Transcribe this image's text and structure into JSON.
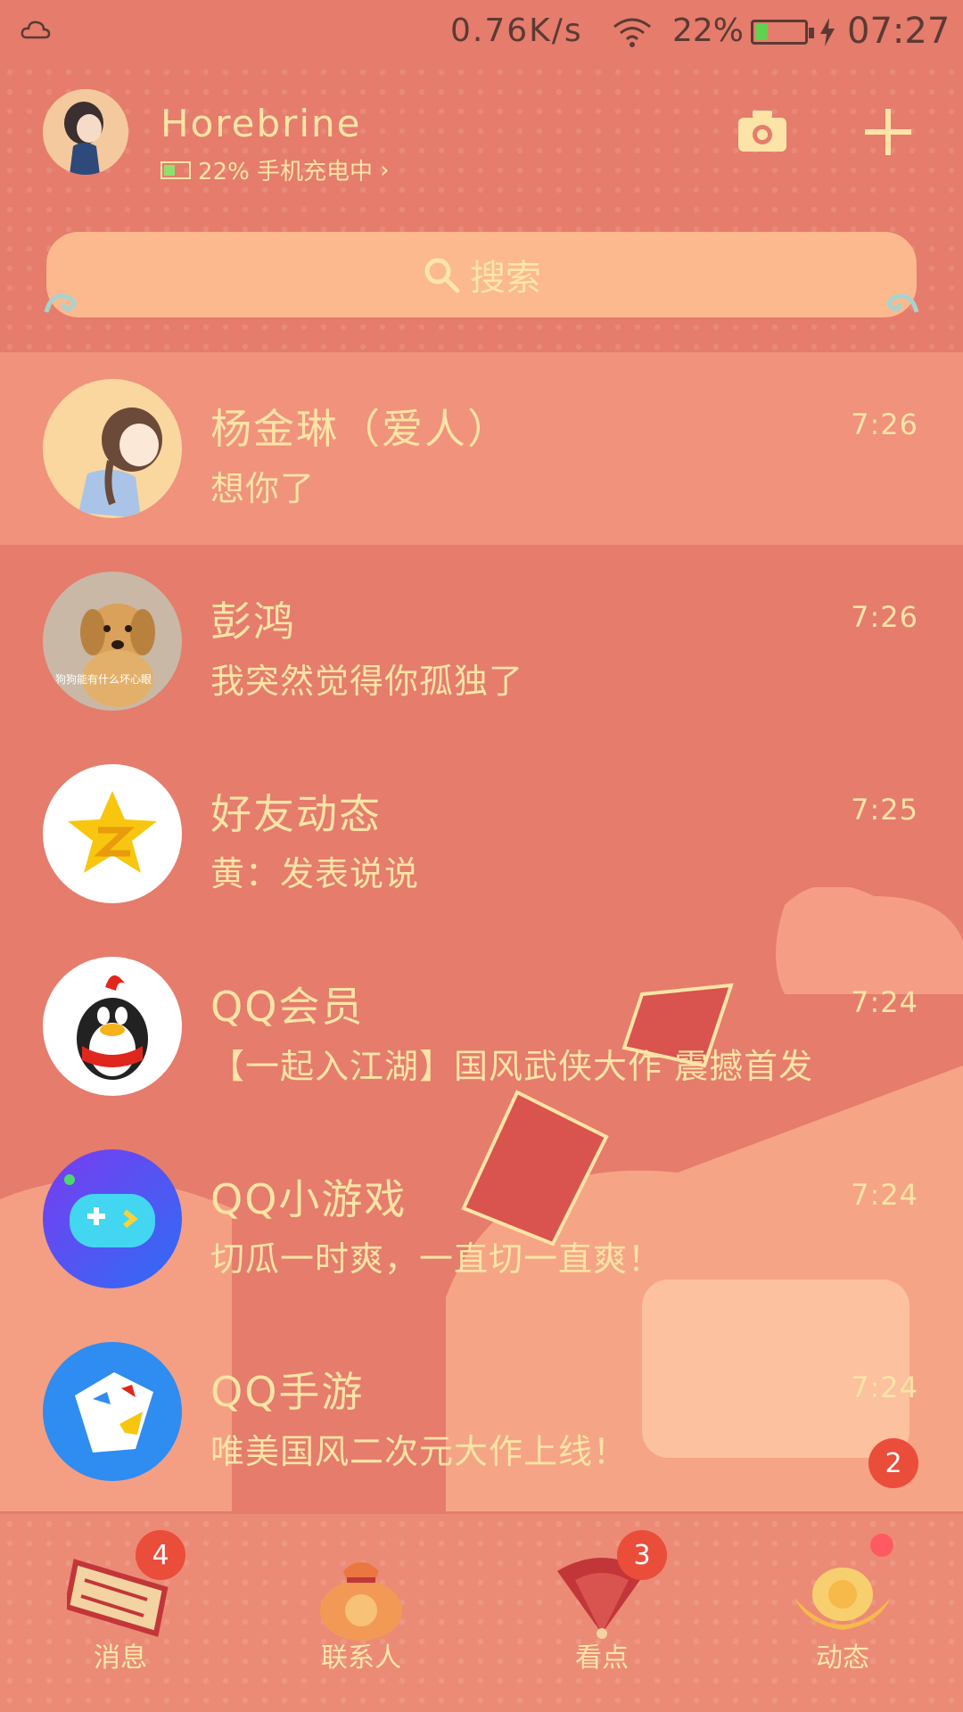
{
  "status_bar": {
    "speed": "0.76K/s",
    "battery_percent": "22%",
    "time": "07:27",
    "icons": [
      "cloud-icon",
      "wifi-icon",
      "battery-icon",
      "charging-bolt-icon"
    ]
  },
  "header": {
    "username": "Horebrine",
    "device_status": "22% 手机充电中",
    "actions": [
      "camera-icon",
      "plus-icon"
    ]
  },
  "search": {
    "label": "搜索"
  },
  "chats": [
    {
      "name": "杨金琳（爱人）",
      "message": "想你了",
      "time": "7:26",
      "pinned": true,
      "unread": null
    },
    {
      "name": "彭鸿",
      "message": "我突然觉得你孤独了",
      "time": "7:26",
      "pinned": false,
      "unread": null,
      "avatar_caption": "狗狗能有什么坏心眼"
    },
    {
      "name": "好友动态",
      "message": "黄：发表说说",
      "time": "7:25",
      "pinned": false,
      "unread": null
    },
    {
      "name": "QQ会员",
      "message": "【一起入江湖】国风武侠大作 震撼首发",
      "time": "7:24",
      "pinned": false,
      "unread": null
    },
    {
      "name": "QQ小游戏",
      "message": "切瓜一时爽，一直切一直爽！",
      "time": "7:24",
      "pinned": false,
      "unread": null
    },
    {
      "name": "QQ手游",
      "message": "唯美国风二次元大作上线！",
      "time": "7:24",
      "pinned": false,
      "unread": "2"
    }
  ],
  "tabs": [
    {
      "label": "消息",
      "badge": "4",
      "icon": "scroll-icon"
    },
    {
      "label": "联系人",
      "badge": null,
      "icon": "fortune-bag-icon"
    },
    {
      "label": "看点",
      "badge": "3",
      "icon": "fan-icon"
    },
    {
      "label": "动态",
      "badge": null,
      "dot": true,
      "icon": "gold-ingot-icon"
    }
  ],
  "colors": {
    "background": "#e57c6c",
    "pinned_row": "#f0927c",
    "search_bar": "#fcb98d",
    "text": "#fbe4a6",
    "badge": "#ea4d3a"
  }
}
